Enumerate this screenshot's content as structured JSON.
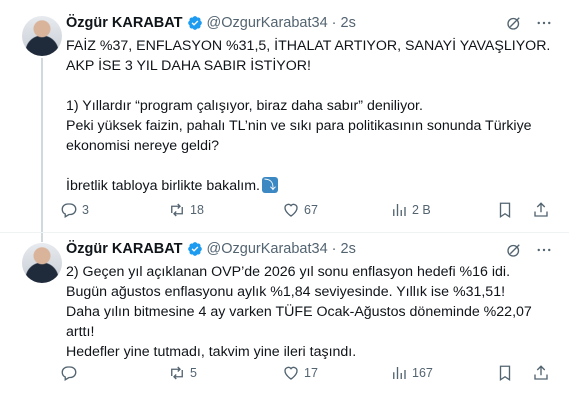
{
  "tweets": [
    {
      "author": {
        "name": "Özgür KARABAT",
        "handle": "@OzgurKarabat34",
        "separator": "·",
        "time": "2s"
      },
      "lines": [
        "FAİZ %37, ENFLASYON %31,5, İTHALAT ARTIYOR, SANAYİ YAVAŞLIYOR.",
        "AKP İSE 3 YIL DAHA SABIR İSTİYOR!",
        "",
        "1) Yıllardır “program çalışıyor, biraz daha sabır” deniliyor.",
        "Peki yüksek faizin, pahalı TL’nin ve sıkı para politikasının sonunda Türkiye",
        "ekonomisi nereye geldi?",
        "",
        "İbretlik tabloya birlikte bakalım."
      ],
      "stats": {
        "replies": "3",
        "reposts": "18",
        "likes": "67",
        "views": "2 B"
      }
    },
    {
      "author": {
        "name": "Özgür KARABAT",
        "handle": "@OzgurKarabat34",
        "separator": "·",
        "time": "2s"
      },
      "lines": [
        "2) Geçen yıl açıklanan OVP’de 2026 yıl sonu enflasyon hedefi %16 idi.",
        "Bugün ağustos enflasyonu aylık %1,84 seviyesinde. Yıllık ise %31,51!",
        "Daha yılın bitmesine 4 ay varken TÜFE Ocak-Ağustos döneminde %22,07",
        "arttı!",
        "Hedefler yine tutmadı, takvim yine ileri taşındı."
      ],
      "stats": {
        "replies": "",
        "reposts": "5",
        "likes": "17",
        "views": "167"
      }
    }
  ],
  "colors": {
    "verified": "#1d9bf0",
    "secondary_text": "#536471",
    "text": "#0f1419"
  },
  "icons": [
    "verified-badge-icon",
    "grok-icon",
    "more-icon",
    "reply-icon",
    "repost-icon",
    "like-icon",
    "views-icon",
    "bookmark-icon",
    "share-icon",
    "down-arrow-emoji-icon"
  ]
}
